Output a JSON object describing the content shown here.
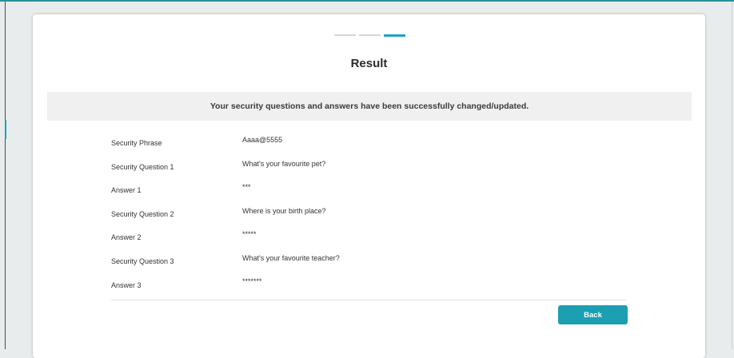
{
  "colors": {
    "accent": "#1c9fb2",
    "step_active": "#1aa3c8",
    "step_inactive": "#d3d6d8",
    "banner_bg": "#f0f0f0",
    "page_bg": "#e9ecec"
  },
  "progress": {
    "total_steps": 3,
    "current_step": 3
  },
  "page": {
    "title": "Result"
  },
  "banner": {
    "message": "Your security questions and answers have been successfully changed/updated."
  },
  "rows": [
    {
      "label": "Security Phrase",
      "value": "Aaaa@5555"
    },
    {
      "label": "Security Question 1",
      "value": "What's your favourite pet?"
    },
    {
      "label": "Answer 1",
      "value": "***"
    },
    {
      "label": "Security Question 2",
      "value": "Where is your birth place?"
    },
    {
      "label": "Answer 2",
      "value": "*****"
    },
    {
      "label": "Security Question 3",
      "value": "What's your favourite teacher?"
    },
    {
      "label": "Answer 3",
      "value": "*******"
    }
  ],
  "actions": {
    "back_label": "Back"
  }
}
